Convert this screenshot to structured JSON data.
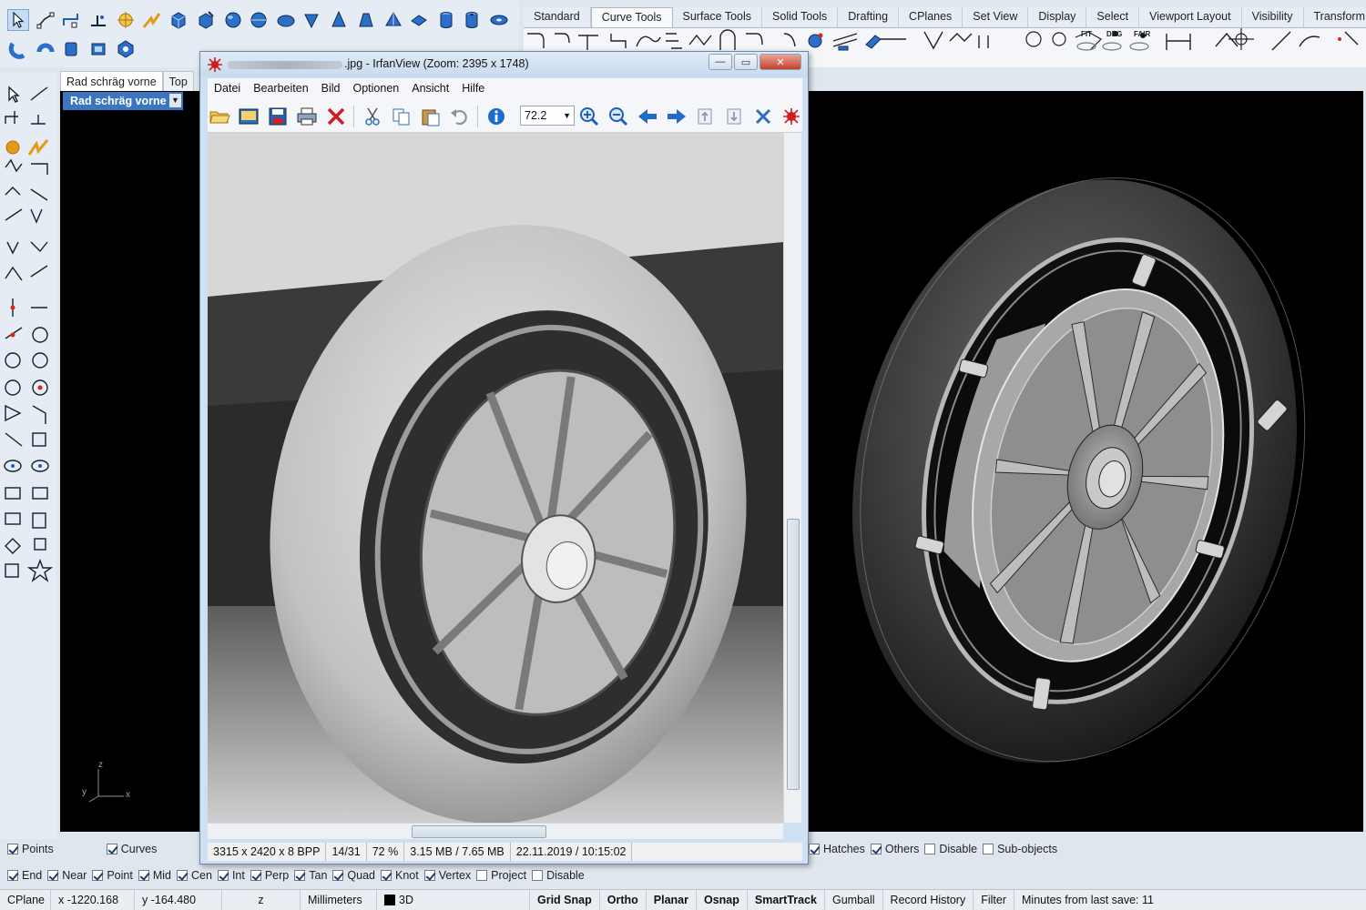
{
  "rhino": {
    "tabs": [
      "Standard",
      "Curve Tools",
      "Surface Tools",
      "Solid Tools",
      "Drafting",
      "CPlanes",
      "Set View",
      "Display",
      "Select",
      "Viewport Layout",
      "Visibility",
      "Transform"
    ],
    "active_tab": "Curve Tools",
    "tab_tool_labels": {
      "fit": "FIT",
      "deg": "DEG",
      "fair": "FAIR"
    },
    "viewport_tabs": [
      "Rad schräg vorne",
      "Top"
    ],
    "viewport_title": "Rad schräg vorne",
    "axis": {
      "x": "x",
      "y": "y",
      "z": "z"
    }
  },
  "irfanview": {
    "title_suffix": ".jpg - IrfanView (Zoom: 2395 x 1748)",
    "menu": [
      "Datei",
      "Bearbeiten",
      "Bild",
      "Optionen",
      "Ansicht",
      "Hilfe"
    ],
    "zoom_value": "72.2",
    "status": [
      "3315 x 2420 x 8 BPP",
      "14/31",
      "72 %",
      "3.15 MB / 7.65 MB",
      "22.11.2019 / 10:15:02"
    ]
  },
  "filters": [
    {
      "label": "Points",
      "checked": true
    },
    {
      "label": "Curves",
      "checked": true
    },
    {
      "label": "Hatches",
      "checked": true
    },
    {
      "label": "Others",
      "checked": true
    },
    {
      "label": "Disable",
      "checked": false
    },
    {
      "label": "Sub-objects",
      "checked": false
    }
  ],
  "osnaps": [
    {
      "label": "End",
      "checked": true
    },
    {
      "label": "Near",
      "checked": true
    },
    {
      "label": "Point",
      "checked": true
    },
    {
      "label": "Mid",
      "checked": true
    },
    {
      "label": "Cen",
      "checked": true
    },
    {
      "label": "Int",
      "checked": true
    },
    {
      "label": "Perp",
      "checked": true
    },
    {
      "label": "Tan",
      "checked": true
    },
    {
      "label": "Quad",
      "checked": true
    },
    {
      "label": "Knot",
      "checked": true
    },
    {
      "label": "Vertex",
      "checked": true
    },
    {
      "label": "Project",
      "checked": false
    },
    {
      "label": "Disable",
      "checked": false
    }
  ],
  "statusbar": {
    "cplane": "CPlane",
    "x": "x -1220.168",
    "y": "y -164.480",
    "z": "z",
    "units": "Millimeters",
    "layer": "3D",
    "grid_snap": "Grid Snap",
    "ortho": "Ortho",
    "planar": "Planar",
    "osnap": "Osnap",
    "smarttrack": "SmartTrack",
    "gumball": "Gumball",
    "record_history": "Record History",
    "filter": "Filter",
    "minutes": "Minutes from last save: 11"
  },
  "colors": {
    "viewport_bg": "#000000",
    "viewport_title_bg": "#3c76c0",
    "accent_blue": "#1f5fb8"
  }
}
